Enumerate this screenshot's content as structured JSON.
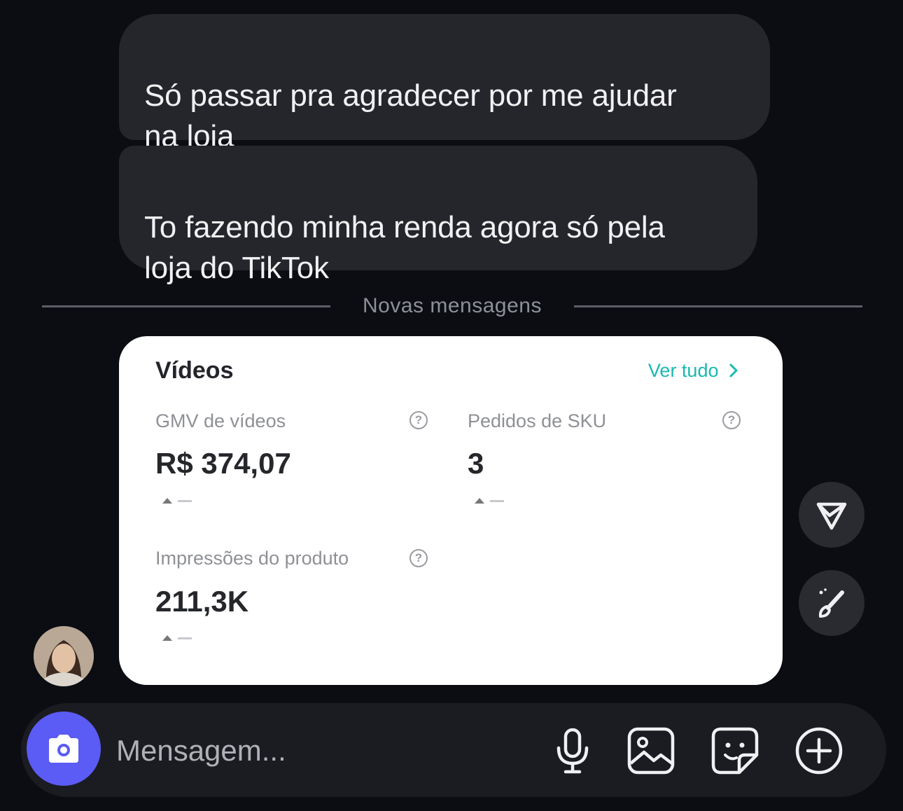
{
  "messages": [
    {
      "text": "Só passar pra agradecer por me ajudar\nna loja"
    },
    {
      "text": "To fazendo minha renda agora só pela\nloja do TikTok"
    }
  ],
  "divider": {
    "label": "Novas mensagens"
  },
  "card": {
    "title": "Vídeos",
    "see_all": "Ver tudo",
    "metrics": [
      {
        "label": "GMV de vídeos",
        "value": "R$ 374,07"
      },
      {
        "label": "Pedidos de SKU",
        "value": "3"
      },
      {
        "label": "Impressões do produto",
        "value": "211,3K"
      }
    ]
  },
  "composer": {
    "placeholder": "Mensagem..."
  },
  "icons": {
    "camera": "camera-icon",
    "microphone": "microphone-icon",
    "gallery": "image-icon",
    "sticker": "sticker-icon",
    "add": "plus-circle-icon",
    "share": "send-icon",
    "edit": "paintbrush-icon"
  },
  "colors": {
    "background": "#0b0d13",
    "bubble": "#25262c",
    "accent": "#5b5bf5",
    "link": "#19b8b0"
  }
}
